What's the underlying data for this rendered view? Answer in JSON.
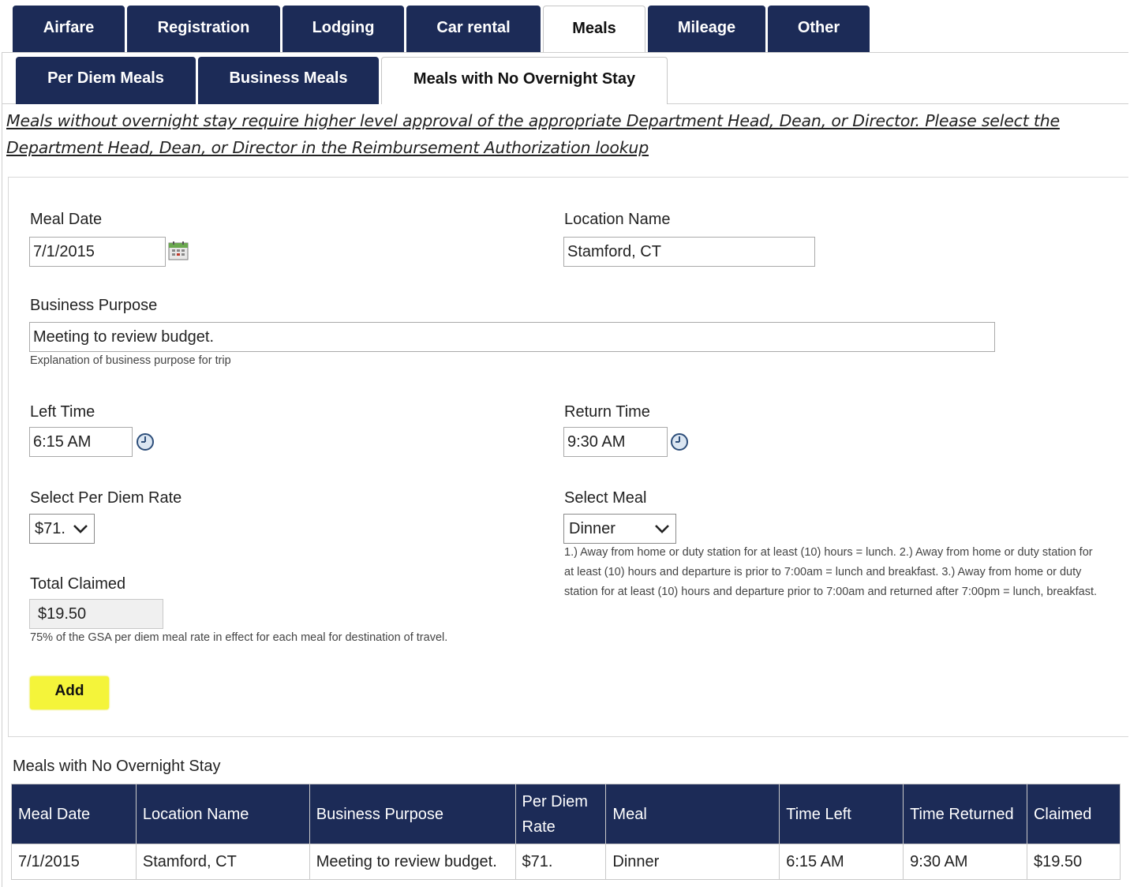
{
  "tabs": [
    "Airfare",
    "Registration",
    "Lodging",
    "Car rental",
    "Meals",
    "Mileage",
    "Other"
  ],
  "active_tab": "Meals",
  "subtabs": [
    "Per Diem Meals",
    "Business Meals",
    "Meals with No Overnight Stay"
  ],
  "active_subtab": "Meals with No Overnight Stay",
  "notice": "Meals without overnight stay require higher level approval of the appropriate Department Head, Dean, or Director. Please select the Department Head, Dean, or Director in the Reimbursement Authorization lookup",
  "form": {
    "meal_date_label": "Meal Date",
    "meal_date_value": "7/1/2015",
    "location_label": "Location Name",
    "location_value": "Stamford, CT",
    "purpose_label": "Business Purpose",
    "purpose_value": "Meeting to review budget.",
    "purpose_help": "Explanation of business purpose for trip",
    "left_time_label": "Left Time",
    "left_time_value": "6:15 AM",
    "return_time_label": "Return Time",
    "return_time_value": "9:30 AM",
    "rate_label": "Select Per Diem Rate",
    "rate_value": "$71.",
    "meal_label": "Select Meal",
    "meal_value": "Dinner",
    "meal_help": "1.) Away from home or duty station for at least (10) hours = lunch. 2.) Away from home or duty station for at least (10) hours and departure is prior to 7:00am = lunch and breakfast. 3.) Away from home or duty station for at least (10) hours and departure prior to 7:00am and returned after 7:00pm = lunch, breakfast.",
    "total_label": "Total Claimed",
    "total_value": "$19.50",
    "total_help": "75% of the GSA per diem meal rate in effect for each meal for destination of travel.",
    "add_label": "Add"
  },
  "table": {
    "title": "Meals with No Overnight Stay",
    "headers": [
      "Meal Date",
      "Location Name",
      "Business Purpose",
      "Per Diem Rate",
      "Meal",
      "Time Left",
      "Time Returned",
      "Claimed"
    ],
    "rows": [
      [
        "7/1/2015",
        "Stamford, CT",
        "Meeting to review budget.",
        "$71.",
        "Dinner",
        "6:15 AM",
        "9:30 AM",
        "$19.50"
      ]
    ]
  },
  "colors": {
    "tab_bg": "#1c2b57",
    "highlight": "#f4f43a"
  },
  "icons": {
    "calendar": "calendar-icon",
    "clock": "clock-icon",
    "dropdown": "chevron-down-icon"
  }
}
